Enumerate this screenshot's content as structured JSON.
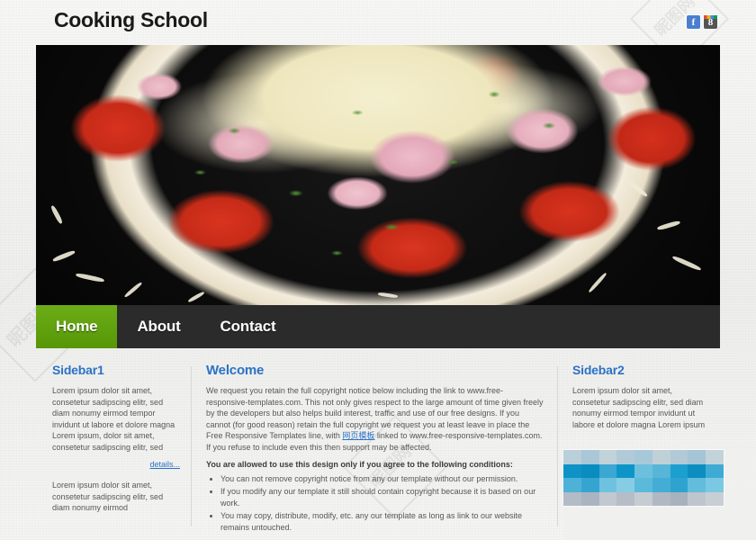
{
  "header": {
    "site_title": "Cooking School",
    "social": [
      {
        "name": "facebook",
        "glyph": "f"
      },
      {
        "name": "google-plus",
        "glyph": "8"
      }
    ]
  },
  "hero": {
    "alt": "Pizza with tomato slices, ham and shredded cheese on a black plate"
  },
  "nav": {
    "items": [
      {
        "label": "Home",
        "active": true
      },
      {
        "label": "About",
        "active": false
      },
      {
        "label": "Contact",
        "active": false
      }
    ]
  },
  "sidebar1": {
    "title": "Sidebar1",
    "paragraph1": "Lorem ipsum dolor sit amet, consetetur sadipscing elitr, sed diam nonumy eirmod tempor invidunt ut labore et dolore magna Lorem ipsum, dolor sit amet, consetetur sadipscing elitr, sed",
    "details_label": "details...",
    "paragraph2": "Lorem ipsum dolor sit amet, consetetur sadipscing elitr, sed diam nonumy eirmod"
  },
  "main": {
    "title": "Welcome",
    "intro_before_link": "We request you retain the full copyright notice below including the link to www.free-responsive-templates.com. This not only gives respect to the large amount of time given freely by the developers but also helps build interest, traffic and use of our free designs. If you cannot (for good reason) retain the full copyright we request you at least leave in place the Free Responsive Templates line, with ",
    "intro_link_text": "网页模板",
    "intro_after_link": " linked to www.free-responsive-templates.com. If you refuse to include even this then support may be affected.",
    "terms_lead": "You are allowed to use this design only if you agree to the following conditions:",
    "terms": [
      "You can not remove copyright notice from any our template without our permission.",
      "If you modify any our template it still should contain copyright because it is based on our work.",
      "You may copy, distribute, modify, etc. any our template as long as link to our website remains untouched."
    ]
  },
  "sidebar2": {
    "title": "Sidebar2",
    "paragraph1": "Lorem ipsum dolor sit amet, consetetur sadipscing elitr, sed diam nonumy eirmod tempor invidunt ut labore et dolore magna Lorem ipsum"
  },
  "watermarks": [
    {
      "text": "昵图网"
    },
    {
      "text": "昵图网"
    },
    {
      "text": "昵图网"
    }
  ],
  "colors": {
    "accent_green": "#61a310",
    "nav_bar": "#2b2b2b",
    "heading_blue": "#2b72c6",
    "link_blue": "#2b72c6",
    "body_text": "#575757",
    "page_bg": "#f2f2f0",
    "mosaic_blue": "#0f97c7"
  },
  "mosaic": {
    "label": "censored-region",
    "tiles": [
      "#b9cfd9",
      "#a9c7d6",
      "#c2d2d9",
      "#b0cad8",
      "#a7c8d9",
      "#bfd0d7",
      "#b2c9d6",
      "#a5c4d6",
      "#c3d3da",
      "#0d93c6",
      "#0b8cbf",
      "#3aa8d2",
      "#0e95c8",
      "#6cc0de",
      "#57b6d8",
      "#1a9fce",
      "#0c8ec1",
      "#3fabd4",
      "#4eb2d7",
      "#35a5d0",
      "#6ec2df",
      "#86cde4",
      "#5bb9da",
      "#44add5",
      "#2fa3cf",
      "#62bddc",
      "#7bc8e2",
      "#b3bcc6",
      "#aab4c0",
      "#c2c8d0",
      "#b6bdc7",
      "#c7ccd3",
      "#b0b8c3",
      "#a8b2bf",
      "#bfc5ce",
      "#c9ced5"
    ]
  }
}
